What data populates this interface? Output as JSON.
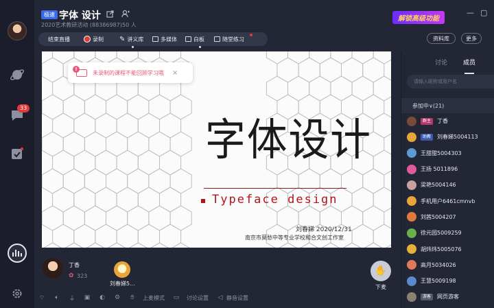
{
  "header": {
    "tag": "极速",
    "title": "字体 设计",
    "subtitle": "2020艺术教研活动 (88386987)",
    "members": "50 人",
    "promo": "解锁高级功能"
  },
  "toolbar": {
    "end_live": "结束直播",
    "record": "录制",
    "handout": "讲义库",
    "multimedia": "多媒体",
    "whiteboard": "白板",
    "quiz": "随堂练习",
    "resource": "资料库",
    "more": "更多"
  },
  "rail": {
    "unread": "33"
  },
  "notice": {
    "text": "未录制的课程不能回顾学习哦",
    "close": "×"
  },
  "slide": {
    "title_cn": "字体设计",
    "title_en": "Typeface design",
    "author_date": "刘春娣   2020/12/31",
    "school": "南京市莫愁中等专业学校和合文创工作室"
  },
  "stage_bottom": {
    "teacher_name": "丁香",
    "teacher_score": "323",
    "student_name": "刘春娣5...",
    "hand_label": "下麦",
    "mode_label": "上麦模式",
    "discuss_label": "讨论设置",
    "mute_label": "静音设置"
  },
  "panel": {
    "tab_discuss": "讨论",
    "tab_members": "成员",
    "search_placeholder": "请输入昵称或用户名",
    "group_label": "参加中∨(21)",
    "members": [
      {
        "name": "丁香",
        "tag": "群主",
        "tag_color": "#b03a6a",
        "avatar_color": "#7a4a3a"
      },
      {
        "name": "刘春娣5004113",
        "tag": "助教",
        "tag_color": "#3a5ab0",
        "avatar_color": "#e8a53a"
      },
      {
        "name": "王甜甜5004303",
        "tag": "",
        "tag_color": "",
        "avatar_color": "#5a9ad0"
      },
      {
        "name": "王扬 5011896",
        "tag": "",
        "tag_color": "",
        "avatar_color": "#e05a9a"
      },
      {
        "name": "梁艳5004146",
        "tag": "",
        "tag_color": "",
        "avatar_color": "#c9a0a0"
      },
      {
        "name": "手机用户6461cmnvb",
        "tag": "",
        "tag_color": "",
        "avatar_color": "#e8a53a"
      },
      {
        "name": "刘茜5004207",
        "tag": "",
        "tag_color": "",
        "avatar_color": "#e07a3a"
      },
      {
        "name": "徐元园5009259",
        "tag": "",
        "tag_color": "",
        "avatar_color": "#6ab04a"
      },
      {
        "name": "胡炜炜5005076",
        "tag": "",
        "tag_color": "",
        "avatar_color": "#e8b03a"
      },
      {
        "name": "高月5034026",
        "tag": "",
        "tag_color": "",
        "avatar_color": "#e07a5a"
      },
      {
        "name": "王慧5009198",
        "tag": "",
        "tag_color": "",
        "avatar_color": "#5a8ad0"
      },
      {
        "name": "网页游客",
        "tag": "游客",
        "tag_color": "#555a6a",
        "avatar_color": "#8a8070"
      }
    ]
  }
}
